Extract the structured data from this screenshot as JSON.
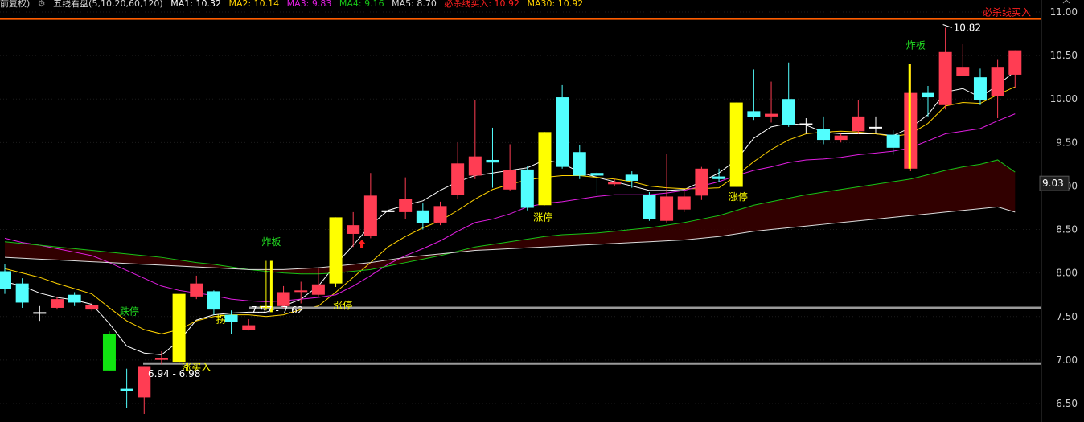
{
  "indicator_bar": {
    "prefix": "前复权)",
    "name": "五线看盘(5,10,20,60,120)",
    "ma1": "MA1: 10.32",
    "ma2": "MA2: 10.14",
    "ma3": "MA3: 9.83",
    "ma4": "MA4: 9.16",
    "ma5": "MA5: 8.70",
    "buy_line": "必杀线买入: 10.92",
    "ma30": "MA30: 10.92"
  },
  "colors": {
    "up": "#ff3d53",
    "down": "#52fefe",
    "limit_up": "#ffff00",
    "limit_down": "#11e411",
    "ma1": "#ffffff",
    "ma2": "#ffd200",
    "ma3": "#e01ee0",
    "ma4": "#17c217",
    "ma5": "#dcdcdc",
    "buy_line": "#ff5d00",
    "signal_green": "#22e022",
    "signal_yellow": "#ffff00"
  },
  "chart_data": {
    "type": "candlestick",
    "y_axis": {
      "min": 6.38,
      "max": 11.05,
      "ticks": [
        11.0,
        10.5,
        10.0,
        9.5,
        9.0,
        8.5,
        8.0,
        7.5,
        7.0,
        6.5
      ]
    },
    "price_tag": "9.03",
    "price_tag_value": 9.03,
    "buy_line": {
      "value": 10.92,
      "label": "必杀线买入"
    },
    "support_lines": [
      {
        "value": 6.96,
        "label": "6.94 - 6.98"
      },
      {
        "value": 7.6,
        "label": "7.57 - 7.62"
      }
    ],
    "max_label": {
      "value": 10.82,
      "text": "10.82"
    },
    "candles": [
      {
        "o": 8.02,
        "c": 7.82,
        "h": 8.1,
        "l": 7.76,
        "s": "down"
      },
      {
        "o": 7.88,
        "c": 7.66,
        "h": 7.94,
        "l": 7.6,
        "s": "down"
      },
      {
        "o": 7.55,
        "c": 7.55,
        "h": 7.62,
        "l": 7.45,
        "s": "flat"
      },
      {
        "o": 7.6,
        "c": 7.7,
        "h": 7.73,
        "l": 7.58,
        "s": "up"
      },
      {
        "o": 7.75,
        "c": 7.66,
        "h": 7.78,
        "l": 7.62,
        "s": "down"
      },
      {
        "o": 7.58,
        "c": 7.63,
        "h": 7.66,
        "l": 7.56,
        "s": "up"
      },
      {
        "o": 7.3,
        "c": 6.88,
        "h": 7.33,
        "l": 6.88,
        "s": "limit_down"
      },
      {
        "o": 6.67,
        "c": 6.64,
        "h": 6.9,
        "l": 6.45,
        "s": "down"
      },
      {
        "o": 6.57,
        "c": 6.93,
        "h": 6.93,
        "l": 6.38,
        "s": "up"
      },
      {
        "o": 7.02,
        "c": 7.02,
        "h": 7.1,
        "l": 6.95,
        "s": "flat"
      },
      {
        "o": 6.98,
        "c": 7.76,
        "h": 7.76,
        "l": 6.95,
        "s": "limit_up"
      },
      {
        "o": 7.73,
        "c": 7.88,
        "h": 7.97,
        "l": 7.7,
        "s": "up"
      },
      {
        "o": 7.79,
        "c": 7.58,
        "h": 7.8,
        "l": 7.52,
        "s": "down"
      },
      {
        "o": 7.52,
        "c": 7.44,
        "h": 7.57,
        "l": 7.3,
        "s": "down"
      },
      {
        "o": 7.35,
        "c": 7.4,
        "h": 7.47,
        "l": 7.34,
        "s": "up"
      },
      {
        "o": 7.62,
        "c": 7.62,
        "h": 8.14,
        "l": 7.57,
        "s": "limit_up"
      },
      {
        "o": 7.62,
        "c": 7.78,
        "h": 7.85,
        "l": 7.6,
        "s": "up"
      },
      {
        "o": 7.8,
        "c": 7.8,
        "h": 7.9,
        "l": 7.65,
        "s": "flat"
      },
      {
        "o": 7.75,
        "c": 7.87,
        "h": 8.05,
        "l": 7.73,
        "s": "up"
      },
      {
        "o": 7.88,
        "c": 8.64,
        "h": 8.64,
        "l": 7.84,
        "s": "limit_up"
      },
      {
        "o": 8.45,
        "c": 8.55,
        "h": 8.7,
        "l": 8.3,
        "s": "up"
      },
      {
        "o": 8.43,
        "c": 8.89,
        "h": 9.15,
        "l": 8.4,
        "s": "up"
      },
      {
        "o": 8.7,
        "c": 8.72,
        "h": 8.78,
        "l": 8.62,
        "s": "flat"
      },
      {
        "o": 8.7,
        "c": 8.85,
        "h": 9.1,
        "l": 8.62,
        "s": "up"
      },
      {
        "o": 8.72,
        "c": 8.57,
        "h": 8.8,
        "l": 8.5,
        "s": "down"
      },
      {
        "o": 8.58,
        "c": 8.77,
        "h": 8.82,
        "l": 8.55,
        "s": "up"
      },
      {
        "o": 8.9,
        "c": 9.26,
        "h": 9.5,
        "l": 8.85,
        "s": "up"
      },
      {
        "o": 9.12,
        "c": 9.34,
        "h": 9.99,
        "l": 9.08,
        "s": "up"
      },
      {
        "o": 9.3,
        "c": 9.27,
        "h": 9.67,
        "l": 8.98,
        "s": "down"
      },
      {
        "o": 8.96,
        "c": 9.18,
        "h": 9.48,
        "l": 8.95,
        "s": "up"
      },
      {
        "o": 9.19,
        "c": 8.75,
        "h": 9.23,
        "l": 8.72,
        "s": "down"
      },
      {
        "o": 8.78,
        "c": 9.62,
        "h": 9.62,
        "l": 8.78,
        "s": "limit_up"
      },
      {
        "o": 10.02,
        "c": 9.22,
        "h": 10.16,
        "l": 9.2,
        "s": "down"
      },
      {
        "o": 9.39,
        "c": 9.12,
        "h": 9.47,
        "l": 9.08,
        "s": "down"
      },
      {
        "o": 9.15,
        "c": 9.12,
        "h": 9.16,
        "l": 8.9,
        "s": "down"
      },
      {
        "o": 9.05,
        "c": 9.02,
        "h": 9.08,
        "l": 9.0,
        "s": "flat"
      },
      {
        "o": 9.13,
        "c": 9.06,
        "h": 9.17,
        "l": 8.98,
        "s": "down"
      },
      {
        "o": 8.9,
        "c": 8.62,
        "h": 8.93,
        "l": 8.6,
        "s": "down"
      },
      {
        "o": 8.6,
        "c": 8.88,
        "h": 9.37,
        "l": 8.58,
        "s": "up"
      },
      {
        "o": 8.73,
        "c": 8.88,
        "h": 8.94,
        "l": 8.7,
        "s": "up"
      },
      {
        "o": 8.89,
        "c": 9.2,
        "h": 9.22,
        "l": 8.84,
        "s": "up"
      },
      {
        "o": 9.11,
        "c": 9.08,
        "h": 9.2,
        "l": 9.05,
        "s": "down"
      },
      {
        "o": 8.99,
        "c": 9.96,
        "h": 9.96,
        "l": 8.99,
        "s": "limit_up"
      },
      {
        "o": 9.86,
        "c": 9.79,
        "h": 10.34,
        "l": 9.76,
        "s": "down"
      },
      {
        "o": 9.8,
        "c": 9.83,
        "h": 10.2,
        "l": 9.73,
        "s": "up"
      },
      {
        "o": 10.0,
        "c": 9.7,
        "h": 10.42,
        "l": 9.68,
        "s": "down"
      },
      {
        "o": 9.7,
        "c": 9.72,
        "h": 9.78,
        "l": 9.6,
        "s": "flat"
      },
      {
        "o": 9.66,
        "c": 9.53,
        "h": 9.8,
        "l": 9.48,
        "s": "down"
      },
      {
        "o": 9.53,
        "c": 9.58,
        "h": 9.6,
        "l": 9.5,
        "s": "up"
      },
      {
        "o": 9.63,
        "c": 9.8,
        "h": 9.99,
        "l": 9.6,
        "s": "up"
      },
      {
        "o": 9.68,
        "c": 9.67,
        "h": 9.8,
        "l": 9.6,
        "s": "flat"
      },
      {
        "o": 9.59,
        "c": 9.44,
        "h": 9.64,
        "l": 9.36,
        "s": "down"
      },
      {
        "o": 9.2,
        "c": 10.07,
        "h": 10.4,
        "l": 9.17,
        "s": "up"
      },
      {
        "o": 10.07,
        "c": 10.02,
        "h": 10.15,
        "l": 9.8,
        "s": "down"
      },
      {
        "o": 9.93,
        "c": 10.54,
        "h": 10.82,
        "l": 9.88,
        "s": "up"
      },
      {
        "o": 10.27,
        "c": 10.37,
        "h": 10.63,
        "l": 10.27,
        "s": "up"
      },
      {
        "o": 10.25,
        "c": 9.99,
        "h": 10.35,
        "l": 9.93,
        "s": "down"
      },
      {
        "o": 10.03,
        "c": 10.37,
        "h": 10.45,
        "l": 9.78,
        "s": "up"
      },
      {
        "o": 10.28,
        "c": 10.56,
        "h": 10.56,
        "l": 10.13,
        "s": "up"
      }
    ],
    "ma_lines": [
      {
        "name": "MA1",
        "color": "#ffffff",
        "values": [
          7.9,
          7.85,
          7.77,
          7.72,
          7.69,
          7.64,
          7.42,
          7.16,
          7.08,
          7.06,
          7.22,
          7.46,
          7.52,
          7.54,
          7.55,
          7.55,
          7.62,
          7.7,
          7.85,
          8.1,
          8.32,
          8.55,
          8.72,
          8.78,
          8.83,
          8.95,
          9.05,
          9.12,
          9.15,
          9.18,
          9.21,
          9.3,
          9.26,
          9.16,
          9.1,
          9.05,
          9.0,
          8.95,
          8.95,
          8.96,
          9.05,
          9.15,
          9.3,
          9.55,
          9.68,
          9.72,
          9.7,
          9.62,
          9.6,
          9.6,
          9.6,
          9.58,
          9.67,
          9.82,
          10.08,
          10.12,
          10.02,
          10.16,
          10.32
        ]
      },
      {
        "name": "MA2",
        "color": "#ffd200",
        "values": [
          8.05,
          8.0,
          7.95,
          7.88,
          7.82,
          7.76,
          7.6,
          7.45,
          7.35,
          7.3,
          7.35,
          7.45,
          7.5,
          7.52,
          7.52,
          7.5,
          7.52,
          7.58,
          7.62,
          7.78,
          7.95,
          8.12,
          8.3,
          8.42,
          8.52,
          8.6,
          8.72,
          8.85,
          8.96,
          9.02,
          9.07,
          9.1,
          9.12,
          9.12,
          9.1,
          9.08,
          9.05,
          9.0,
          8.98,
          8.97,
          8.97,
          8.98,
          9.12,
          9.28,
          9.42,
          9.53,
          9.6,
          9.62,
          9.63,
          9.62,
          9.6,
          9.57,
          9.6,
          9.72,
          9.92,
          9.96,
          9.95,
          10.05,
          10.14
        ]
      },
      {
        "name": "MA3",
        "color": "#e01ee0",
        "values": [
          8.4,
          8.35,
          8.32,
          8.28,
          8.24,
          8.2,
          8.12,
          8.03,
          7.94,
          7.85,
          7.8,
          7.77,
          7.74,
          7.7,
          7.68,
          7.67,
          7.68,
          7.7,
          7.72,
          7.75,
          7.85,
          7.97,
          8.1,
          8.2,
          8.28,
          8.37,
          8.48,
          8.58,
          8.62,
          8.68,
          8.76,
          8.8,
          8.82,
          8.85,
          8.88,
          8.9,
          8.9,
          8.9,
          8.92,
          8.95,
          9.0,
          9.05,
          9.12,
          9.18,
          9.22,
          9.27,
          9.3,
          9.31,
          9.33,
          9.36,
          9.38,
          9.4,
          9.44,
          9.52,
          9.6,
          9.63,
          9.66,
          9.75,
          9.83
        ]
      },
      {
        "name": "MA4",
        "color": "#17c217",
        "values": [
          8.36,
          8.34,
          8.32,
          8.3,
          8.28,
          8.26,
          8.24,
          8.22,
          8.2,
          8.18,
          8.15,
          8.12,
          8.1,
          8.07,
          8.04,
          8.02,
          8.0,
          7.99,
          7.99,
          8.0,
          8.02,
          8.04,
          8.08,
          8.12,
          8.16,
          8.2,
          8.25,
          8.3,
          8.33,
          8.36,
          8.39,
          8.42,
          8.44,
          8.45,
          8.46,
          8.48,
          8.5,
          8.52,
          8.55,
          8.58,
          8.62,
          8.66,
          8.72,
          8.78,
          8.82,
          8.86,
          8.9,
          8.93,
          8.96,
          8.99,
          9.02,
          9.05,
          9.08,
          9.13,
          9.18,
          9.22,
          9.25,
          9.3,
          9.16
        ]
      },
      {
        "name": "MA5",
        "color": "#dcdcdc",
        "values": [
          8.18,
          8.17,
          8.16,
          8.15,
          8.14,
          8.13,
          8.12,
          8.11,
          8.1,
          8.09,
          8.08,
          8.07,
          8.06,
          8.05,
          8.04,
          8.04,
          8.04,
          8.05,
          8.06,
          8.08,
          8.1,
          8.12,
          8.15,
          8.18,
          8.2,
          8.22,
          8.24,
          8.26,
          8.27,
          8.28,
          8.29,
          8.3,
          8.31,
          8.32,
          8.33,
          8.34,
          8.35,
          8.36,
          8.37,
          8.38,
          8.4,
          8.42,
          8.45,
          8.48,
          8.5,
          8.52,
          8.54,
          8.56,
          8.58,
          8.6,
          8.62,
          8.64,
          8.66,
          8.68,
          8.7,
          8.72,
          8.74,
          8.76,
          8.7
        ]
      }
    ],
    "annotations": [
      {
        "text": "跌停",
        "x": 7.15,
        "y": 7.52,
        "color": "#22e022"
      },
      {
        "text": "炸板",
        "x": 15.3,
        "y": 8.32,
        "color": "#22e022"
      },
      {
        "text": "炸板",
        "x": 52.3,
        "y": 10.58,
        "color": "#22e022"
      },
      {
        "text": "涨停",
        "x": 19.4,
        "y": 7.59,
        "color": "#ffff00"
      },
      {
        "text": "涨停",
        "x": 30.9,
        "y": 8.6,
        "color": "#ffff00"
      },
      {
        "text": "涨停",
        "x": 42.1,
        "y": 8.84,
        "color": "#ffff00"
      },
      {
        "text": "拐",
        "x": 12.4,
        "y": 7.43,
        "color": "#ffff00"
      },
      {
        "text": "涨买入",
        "x": 11.0,
        "y": 6.88,
        "color": "#ffff00"
      }
    ],
    "arrows": [
      {
        "x": 20.5,
        "y": 8.33,
        "color": "#ff1e1e"
      }
    ],
    "signal_bars": [
      {
        "x": 15.3,
        "low": 7.55,
        "high": 8.14
      },
      {
        "x": 51.95,
        "low": 9.2,
        "high": 10.4
      }
    ]
  }
}
